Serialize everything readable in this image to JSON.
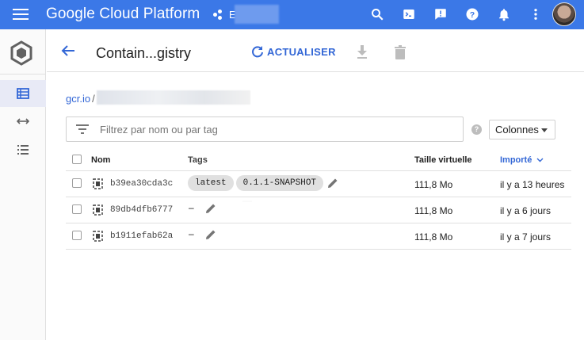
{
  "topbar": {
    "brand": "Google Cloud Platform",
    "project_initial": "E",
    "icons": [
      "menu-icon",
      "search-icon",
      "cloud-shell-icon",
      "feedback-icon",
      "help-icon",
      "notifications-icon",
      "more-vert-icon"
    ]
  },
  "rail": {
    "items": [
      "product-logo-icon",
      "images-list-icon",
      "transfer-icon",
      "settings-list-icon"
    ]
  },
  "header": {
    "title": "Contain...gistry",
    "refresh_label": "ACTUALISER"
  },
  "path": {
    "root": "gcr.io",
    "separator": "/"
  },
  "filter": {
    "placeholder": "Filtrez par nom ou par tag",
    "help": "?",
    "columns_label": "Colonnes"
  },
  "table": {
    "headers": {
      "name": "Nom",
      "tags": "Tags",
      "size": "Taille virtuelle",
      "imported": "Importé"
    },
    "rows": [
      {
        "name": "b39ea30cda3c",
        "tags": [
          "latest",
          "0.1.1-SNAPSHOT"
        ],
        "empty_tag": "",
        "size": "111,8 Mo",
        "imported": "il y a 13 heures"
      },
      {
        "name": "89db4dfb6777",
        "tags": [],
        "empty_tag": "–",
        "size": "111,8 Mo",
        "imported": "il y a 6 jours"
      },
      {
        "name": "b1911efab62a",
        "tags": [],
        "empty_tag": "–",
        "size": "111,8 Mo",
        "imported": "il y a 7 jours"
      }
    ]
  },
  "colors": {
    "topbar": "#3b78e7",
    "accent": "#3367d6",
    "rail_active": "#e8eaf6"
  }
}
